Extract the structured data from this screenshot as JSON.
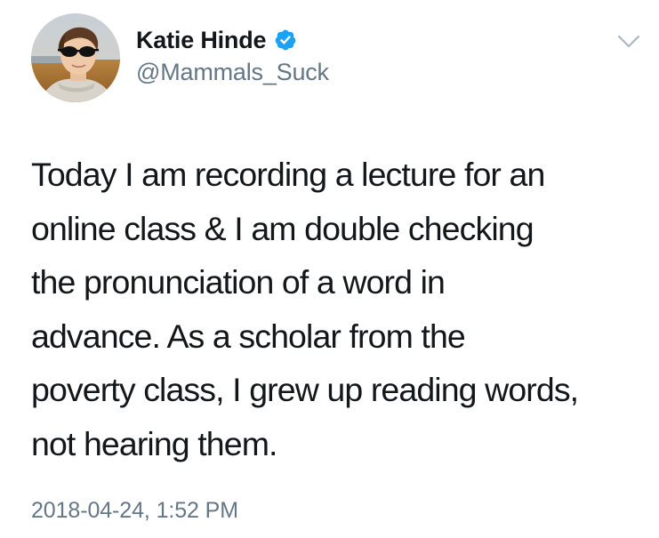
{
  "tweet": {
    "author": {
      "display_name": "Katie Hinde",
      "handle": "@Mammals_Suck",
      "verified": true,
      "verified_badge_color": "#1da1f2"
    },
    "text": "Today I am recording a lecture for an\nonline class & I am double checking\nthe pronunciation of a word in\nadvance. As a scholar from the\npoverty class, I grew up reading words,\nnot hearing them.",
    "timestamp": "2018-04-24, 1:52 PM",
    "menu_icon": "chevron-down-icon",
    "colors": {
      "primary_text": "#14171a",
      "secondary_text": "#657786",
      "caret": "#aab8c2"
    }
  }
}
